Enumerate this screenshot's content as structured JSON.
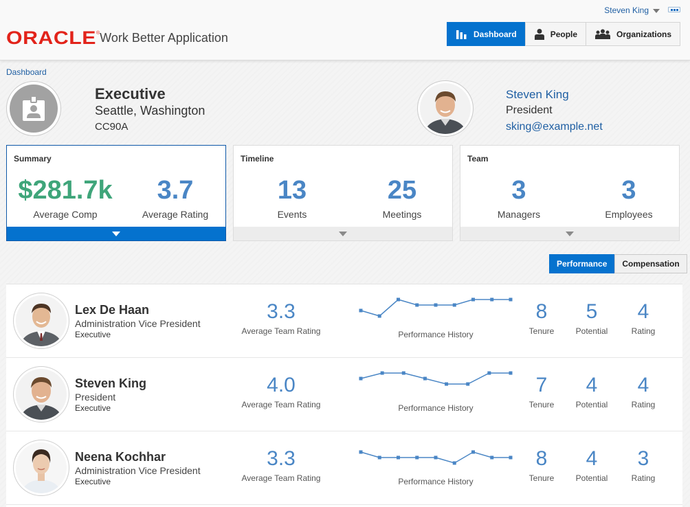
{
  "header": {
    "user_name": "Steven King",
    "brand": "ORACLE",
    "reg_mark": "®",
    "app_title": "Work Better Application",
    "nav": [
      {
        "label": "Dashboard",
        "icon": "bar-chart-icon",
        "active": true
      },
      {
        "label": "People",
        "icon": "person-icon",
        "active": false
      },
      {
        "label": "Organizations",
        "icon": "group-icon",
        "active": false
      }
    ]
  },
  "breadcrumb": "Dashboard",
  "department": {
    "title": "Executive",
    "location": "Seattle, Washington",
    "code": "CC90A"
  },
  "manager": {
    "name": "Steven King",
    "title": "President",
    "email": "sking@example.net"
  },
  "cards": [
    {
      "label": "Summary",
      "selected": true,
      "metrics": [
        {
          "value": "$281.7k",
          "label": "Average Comp"
        },
        {
          "value": "3.7",
          "label": "Average Rating"
        }
      ]
    },
    {
      "label": "Timeline",
      "selected": false,
      "metrics": [
        {
          "value": "13",
          "label": "Events"
        },
        {
          "value": "25",
          "label": "Meetings"
        }
      ]
    },
    {
      "label": "Team",
      "selected": false,
      "metrics": [
        {
          "value": "3",
          "label": "Managers"
        },
        {
          "value": "3",
          "label": "Employees"
        }
      ]
    }
  ],
  "view_toggle": {
    "performance": "Performance",
    "compensation": "Compensation",
    "active": "performance"
  },
  "colors": {
    "accent": "#0572ce",
    "link": "#1f5fa3",
    "metric_blue": "#4a86c5",
    "metric_green": "#3fa57a",
    "brand_red": "#e2231a"
  },
  "employees": [
    {
      "name": "Lex De Haan",
      "title": "Administration Vice President",
      "department": "Executive",
      "avg_team_rating": "3.3",
      "avg_team_rating_label": "Average Team Rating",
      "history_label": "Performance History",
      "history": [
        3,
        2,
        5,
        4,
        4,
        4,
        5,
        5,
        5
      ],
      "tenure": "8",
      "tenure_label": "Tenure",
      "potential": "5",
      "potential_label": "Potential",
      "rating": "4",
      "rating_label": "Rating"
    },
    {
      "name": "Steven King",
      "title": "President",
      "department": "Executive",
      "avg_team_rating": "4.0",
      "avg_team_rating_label": "Average Team Rating",
      "history_label": "Performance History",
      "history": [
        4,
        5,
        5,
        4,
        3,
        3,
        5,
        5
      ],
      "tenure": "7",
      "tenure_label": "Tenure",
      "potential": "4",
      "potential_label": "Potential",
      "rating": "4",
      "rating_label": "Rating"
    },
    {
      "name": "Neena Kochhar",
      "title": "Administration Vice President",
      "department": "Executive",
      "avg_team_rating": "3.3",
      "avg_team_rating_label": "Average Team Rating",
      "history_label": "Performance History",
      "history": [
        4,
        3,
        3,
        3,
        3,
        2,
        4,
        3,
        3
      ],
      "tenure": "8",
      "tenure_label": "Tenure",
      "potential": "4",
      "potential_label": "Potential",
      "rating": "3",
      "rating_label": "Rating"
    }
  ]
}
